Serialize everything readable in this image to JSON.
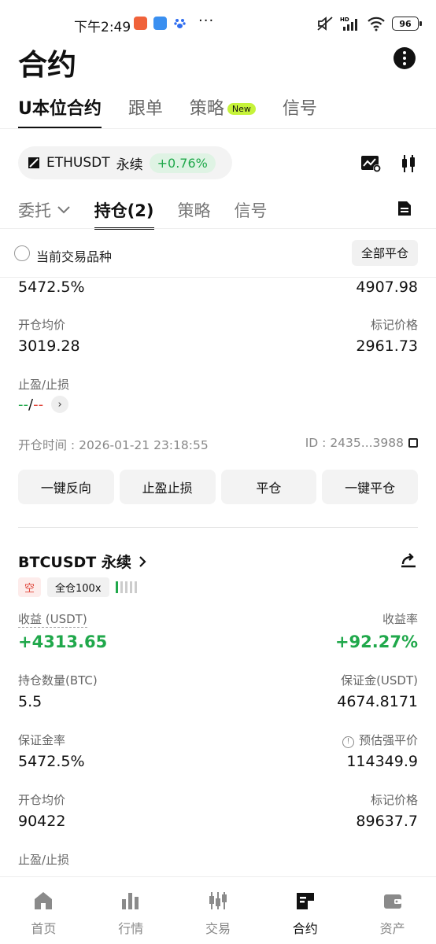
{
  "status_bar": {
    "time": "下午2:49",
    "dots": "···",
    "battery": "96"
  },
  "header": {
    "title": "合约"
  },
  "top_tabs": [
    {
      "label": "U本位合约",
      "active": true
    },
    {
      "label": "跟单"
    },
    {
      "label": "策略",
      "badge": "New"
    },
    {
      "label": "信号"
    }
  ],
  "pair": {
    "symbol": "ETHUSDT",
    "type": "永续",
    "change": "+0.76%"
  },
  "sub_tabs": [
    {
      "label": "委托"
    },
    {
      "label": "持仓(2)",
      "active": true
    },
    {
      "label": "策略"
    },
    {
      "label": "信号"
    }
  ],
  "filter": {
    "label": "当前交易品种",
    "close_all": "全部平仓"
  },
  "position1": {
    "margin_ratio_value": "5472.5%",
    "liq_price_value": "4907.98",
    "entry_label": "开仓均价",
    "entry_value": "3019.28",
    "mark_label": "标记价格",
    "mark_value": "2961.73",
    "tpsl_label": "止盈/止损",
    "tp_value": "--",
    "slash": "/",
    "sl_value": "--",
    "open_time": "开仓时间 : 2026-01-21 23:18:55",
    "id": "ID : 2435...3988",
    "buttons": [
      "一键反向",
      "止盈止损",
      "平仓",
      "一键平仓"
    ]
  },
  "position2": {
    "symbol": "BTCUSDT 永续",
    "side": "空",
    "margin_mode": "全仓100x",
    "leverage_level": 0.2,
    "pnl_label": "收益 (USDT)",
    "pnl_value": "+4313.65",
    "roe_label": "收益率",
    "roe_value": "+92.27%",
    "size_label": "持仓数量(BTC)",
    "size_value": "5.5",
    "margin_label": "保证金(USDT)",
    "margin_value": "4674.8171",
    "margin_ratio_label": "保证金率",
    "margin_ratio_value": "5472.5%",
    "liq_label": "预估强平价",
    "liq_value": "114349.9",
    "entry_label": "开仓均价",
    "entry_value": "90422",
    "mark_label": "标记价格",
    "mark_value": "89637.7",
    "tpsl_label": "止盈/止损"
  },
  "bottom_nav": [
    {
      "label": "首页",
      "icon": "home-icon"
    },
    {
      "label": "行情",
      "icon": "market-icon"
    },
    {
      "label": "交易",
      "icon": "trade-icon"
    },
    {
      "label": "合约",
      "icon": "futures-icon",
      "active": true
    },
    {
      "label": "资产",
      "icon": "wallet-icon"
    }
  ],
  "colors": {
    "green": "#20a84b",
    "red": "#e0453a",
    "accent_badge": "#c6f33a"
  }
}
